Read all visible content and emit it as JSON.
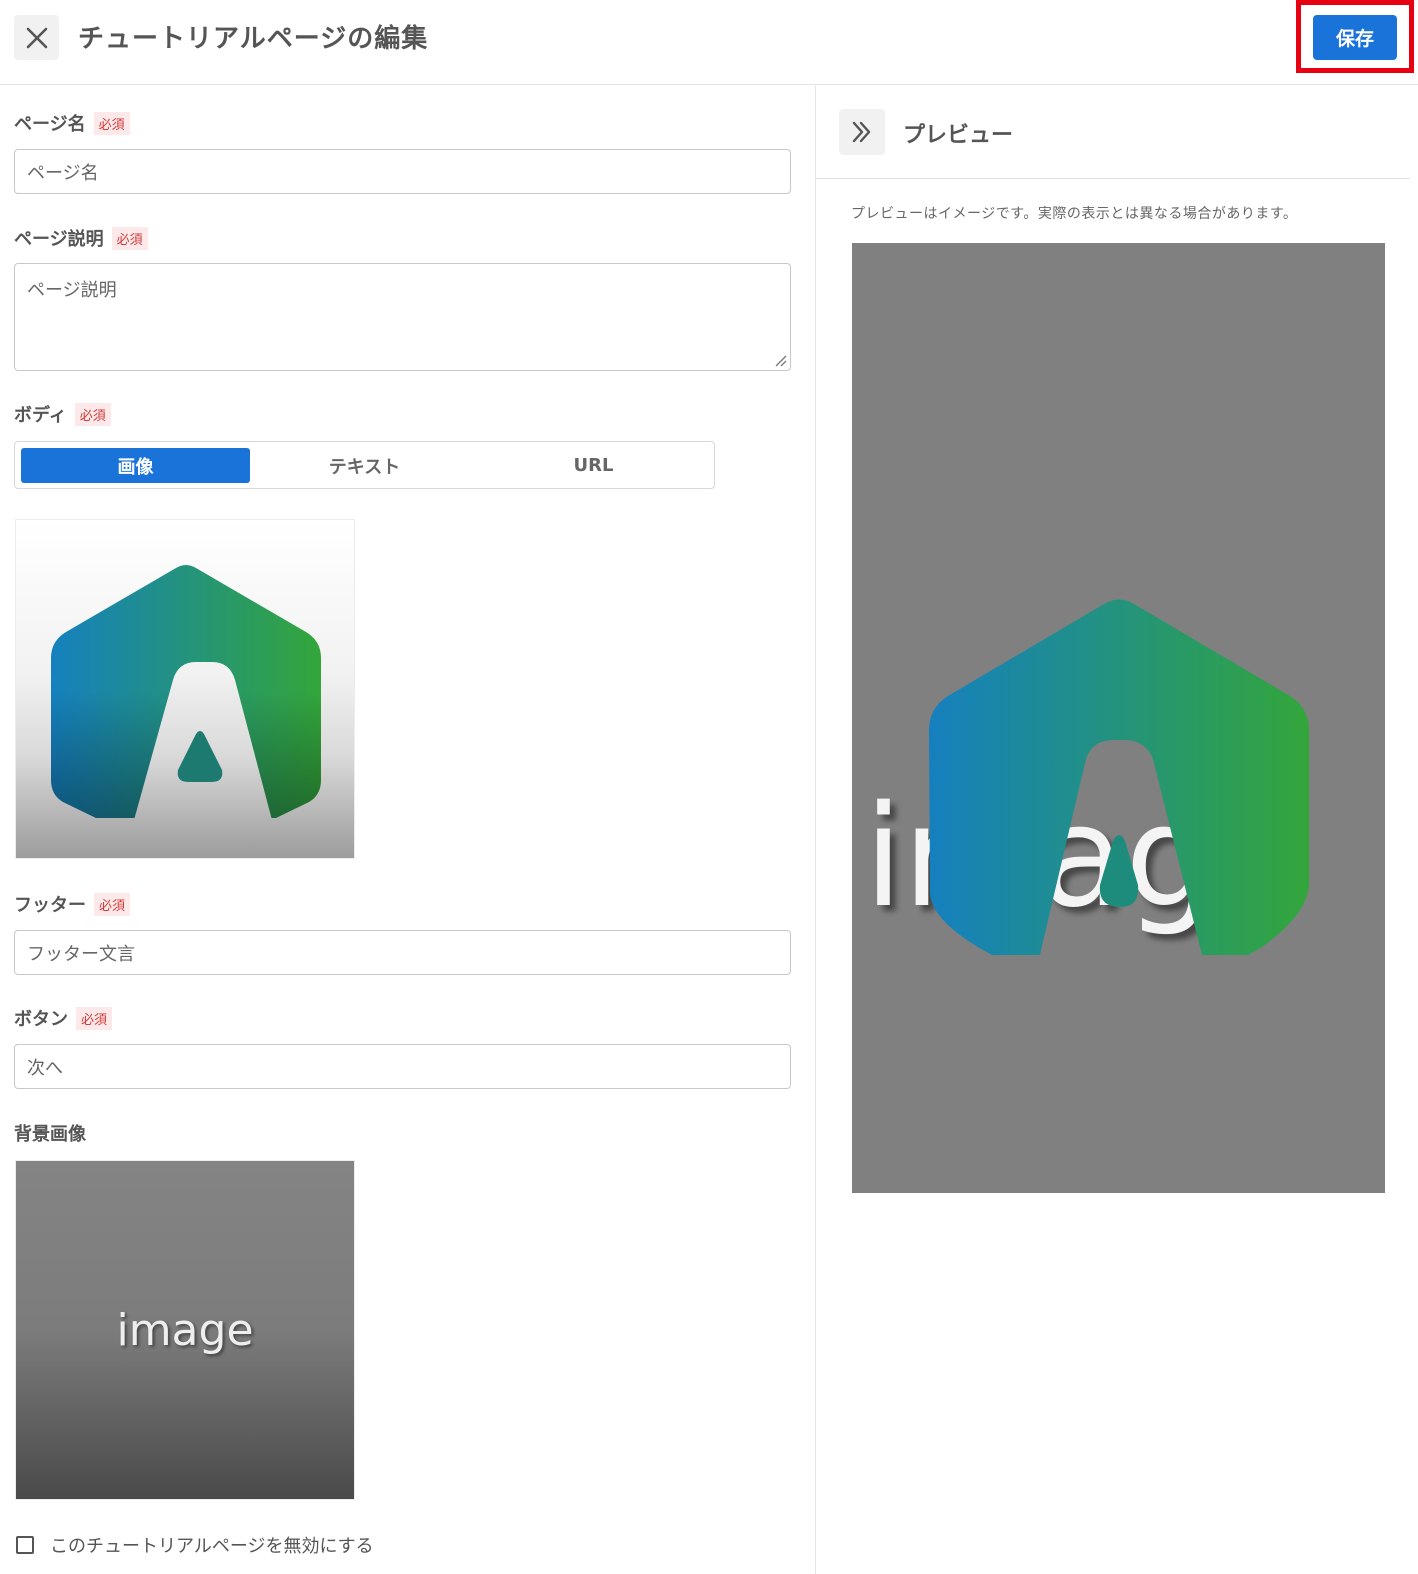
{
  "header": {
    "title": "チュートリアルページの編集",
    "save_label": "保存"
  },
  "form": {
    "required_badge": "必須",
    "page_name": {
      "label": "ページ名",
      "placeholder": "ページ名"
    },
    "page_description": {
      "label": "ページ説明",
      "placeholder": "ページ説明"
    },
    "body": {
      "label": "ボディ",
      "tabs": [
        {
          "label": "画像",
          "active": true
        },
        {
          "label": "テキスト",
          "active": false
        },
        {
          "label": "URL",
          "active": false
        }
      ]
    },
    "footer": {
      "label": "フッター",
      "placeholder": "フッター文言"
    },
    "button": {
      "label": "ボタン",
      "placeholder": "次へ"
    },
    "background_image": {
      "label": "背景画像",
      "image_text": "image"
    },
    "disable_checkbox": {
      "label": "このチュートリアルページを無効にする",
      "checked": false
    }
  },
  "preview": {
    "title": "プレビュー",
    "note": "プレビューはイメージです。実際の表示とは異なる場合があります。",
    "image_text": "image"
  },
  "colors": {
    "accent": "#1a73d9",
    "highlight": "#e60012",
    "required": "#d33b3b",
    "logo_gradient_start": "#1580bf",
    "logo_gradient_end": "#33a63a"
  },
  "icons": {
    "close": "close-icon",
    "expand": "double-chevron-right-icon",
    "logo": "logo-icon"
  }
}
